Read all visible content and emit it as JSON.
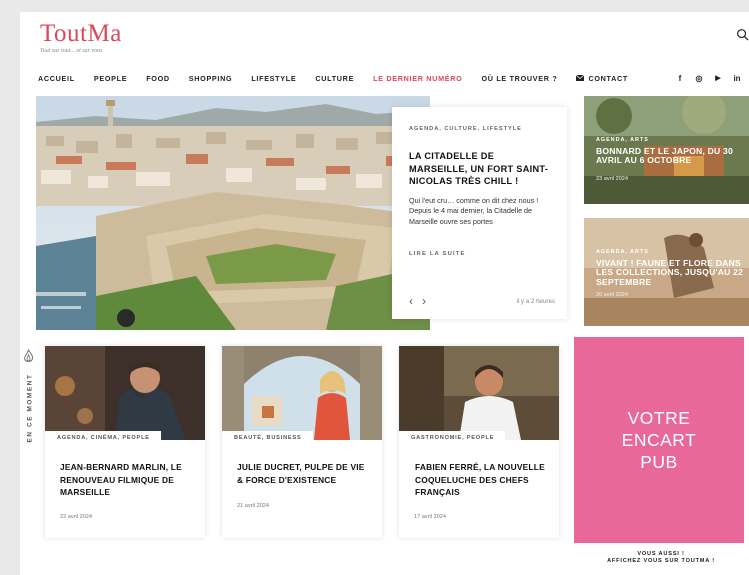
{
  "brand": {
    "logo": "ToutMa",
    "tagline": "Tout sur tout... et sur vous"
  },
  "nav": {
    "items": [
      {
        "label": "ACCUEIL"
      },
      {
        "label": "PEOPLE"
      },
      {
        "label": "FOOD"
      },
      {
        "label": "SHOPPING"
      },
      {
        "label": "LIFESTYLE"
      },
      {
        "label": "CULTURE"
      },
      {
        "label": "LE DERNIER NUMÉRO",
        "active": true
      },
      {
        "label": "OÙ LE TROUVER ?"
      }
    ],
    "contact_label": "CONTACT"
  },
  "social": {
    "facebook": "f",
    "instagram": "◎",
    "youtube": "▶",
    "linkedin": "in"
  },
  "hero": {
    "kicker": "AGENDA, CULTURE, LIFESTYLE",
    "title": "LA CITADELLE DE MARSEILLE, UN FORT SAINT-NICOLAS TRÈS CHILL !",
    "excerpt": "Qui l'eut cru… comme on dit chez nous ! Depuis le 4 mai dernier, la Citadelle de Marseille ouvre ses portes",
    "read_more": "LIRE LA SUITE",
    "prev": "‹",
    "next": "›",
    "time": "il y a 2 heures"
  },
  "side_articles": [
    {
      "kicker": "AGENDA, ARTS",
      "title": "BONNARD ET LE JAPON, DU 30 AVRIL AU 6 OCTOBRE",
      "date": "23 avril 2024"
    },
    {
      "kicker": "AGENDA, ARTS",
      "title": "VIVANT ! FAUNE ET FLORE DANS LES COLLECTIONS, JUSQU'AU 22 SEPTEMBRE",
      "date": "20 avril 2024"
    }
  ],
  "en_ce_moment": "EN CE MOMENT",
  "cards": [
    {
      "kicker": "AGENDA, CINÉMA, PEOPLE",
      "title": "JEAN-BERNARD MARLIN, LE RENOUVEAU FILMIQUE DE MARSEILLE",
      "date": "22 avril 2024"
    },
    {
      "kicker": "BEAUTÉ, BUSINESS",
      "title": "JULIE DUCRET, PULPE DE VIE & FORCE D'EXISTENCE",
      "date": "21 avril 2024"
    },
    {
      "kicker": "GASTRONOMIE, PEOPLE",
      "title": "FABIEN FERRÉ, LA NOUVELLE COQUELUCHE DES CHEFS FRANÇAIS",
      "date": "17 avril 2024"
    }
  ],
  "ad": {
    "lines": [
      "VOTRE",
      "ENCART",
      "PUB"
    ],
    "promo_line1": "VOUS AUSSI !",
    "promo_line2": "AFFICHEZ VOUS SUR TOUTMA !"
  },
  "colors": {
    "brand": "#d9495c",
    "ad_pink": "#e8689b"
  }
}
